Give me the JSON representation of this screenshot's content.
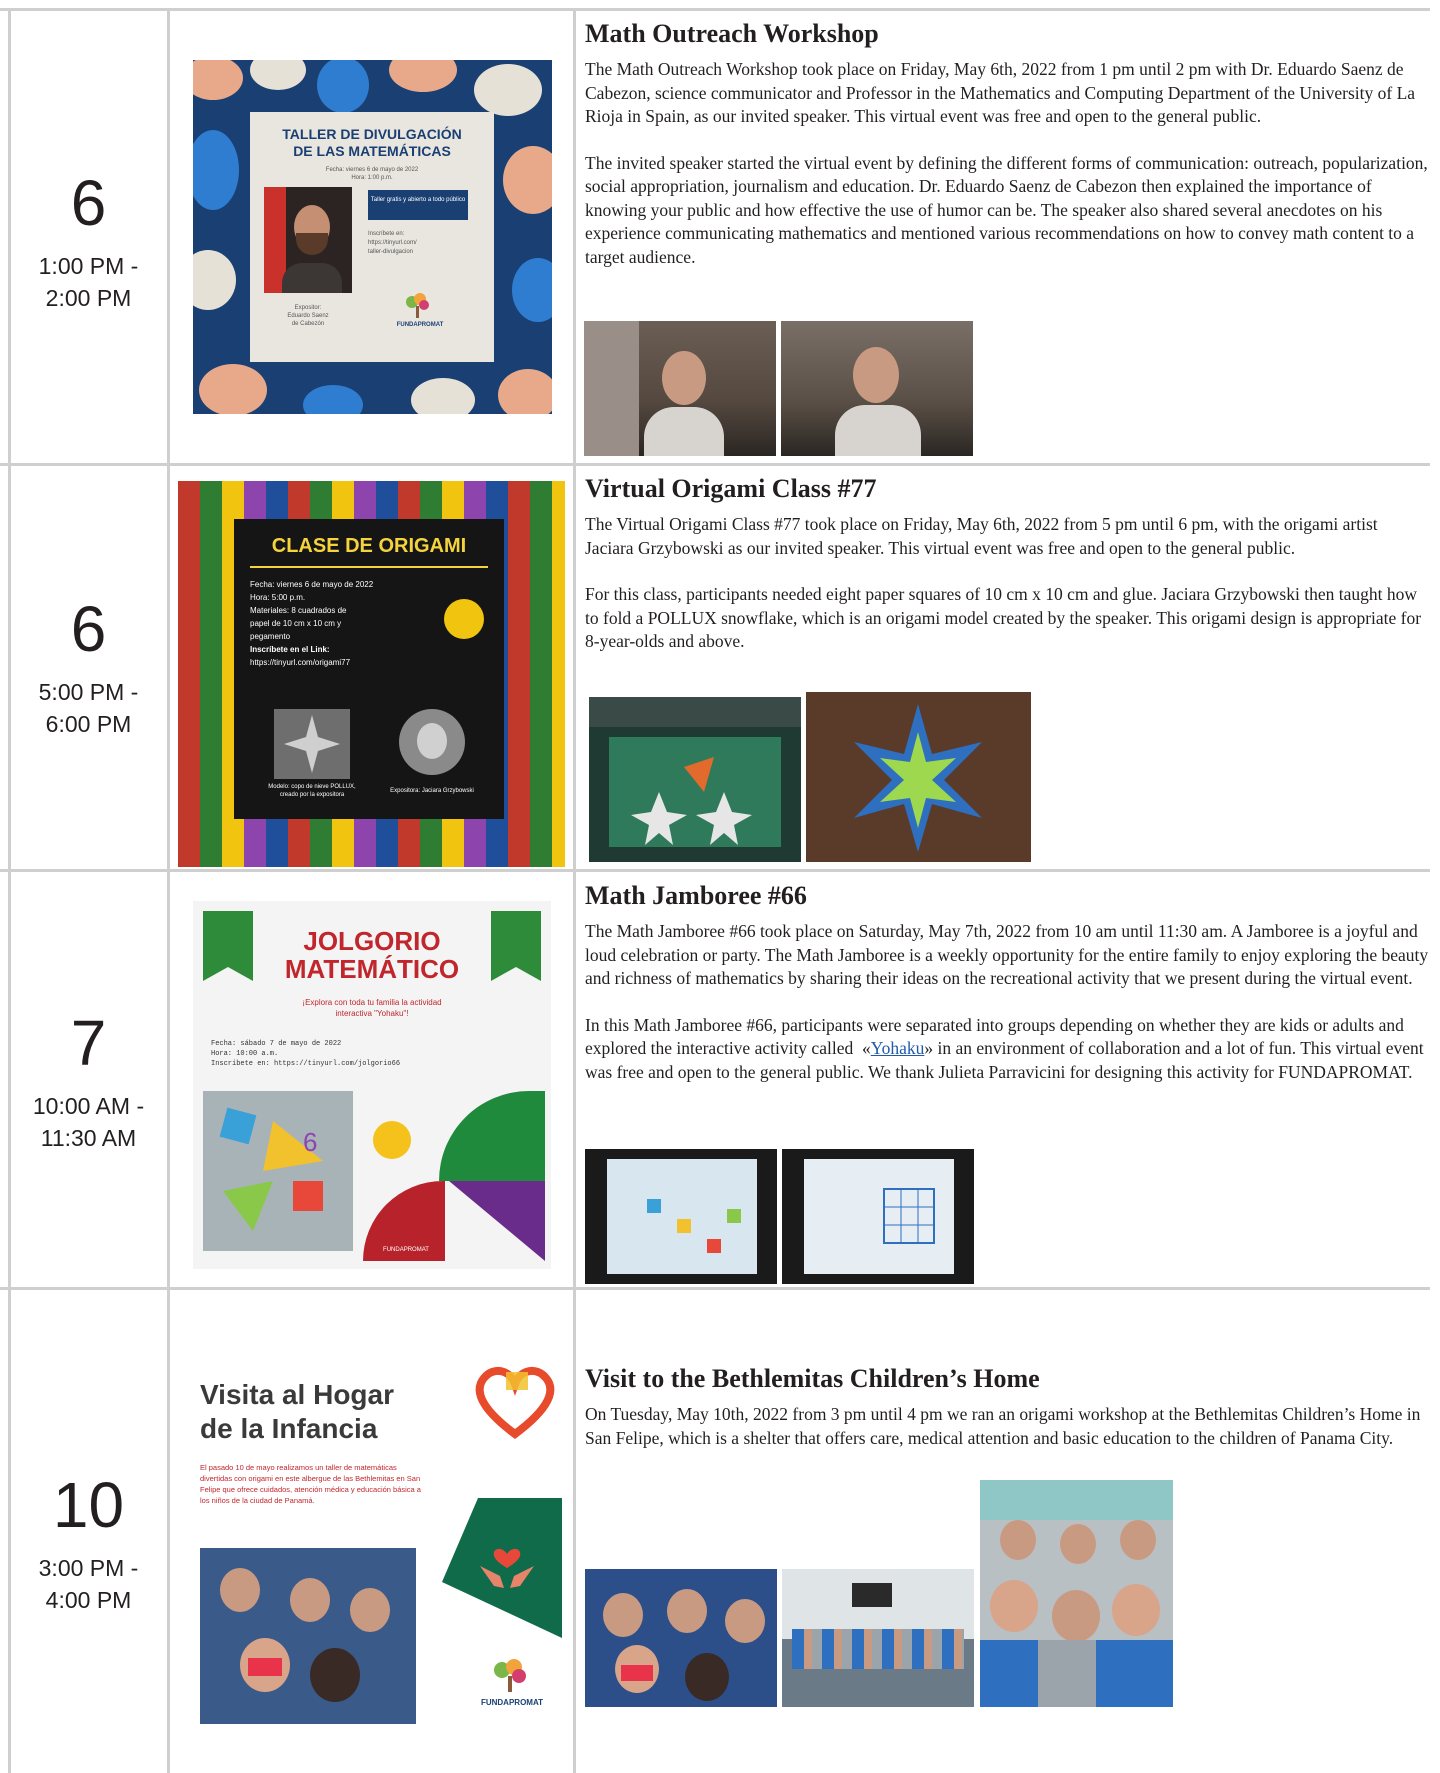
{
  "events": [
    {
      "day": "6",
      "time_line1": "1:00 PM -",
      "time_line2": "2:00 PM",
      "title": "Math Outreach Workshop",
      "paragraphs": [
        "The Math Outreach Workshop took place on Friday, May 6th, 2022 from 1 pm until 2 pm with Dr. Eduardo Saenz de Cabezon, science communicator and Professor in the Mathematics and Computing Department of the University of La Rioja in Spain, as our invited speaker. This virtual event was free and open to the general public.",
        "The invited speaker started the virtual event by defining the different forms of communication: outreach, popularization, social appropriation, journalism and education. Dr. Eduardo Saenz de Cabezon then explained the importance of knowing your public and how effective the use of humor can be. The speaker also shared several anecdotes on his experience communicating mathematics and mentioned various recommendations on how to convey math content to a target audience."
      ],
      "poster": {
        "heading_line1": "TALLER DE DIVULGACIÓN",
        "heading_line2": "DE LAS MATEMÁTICAS",
        "info_line1": "Fecha: viernes 6 de mayo de 2022",
        "info_line2": "Hora: 1:00 p.m.",
        "badge": "Taller gratis y abierto a todo público",
        "link_line1": "Inscríbete en:",
        "link_line2": "https://tinyurl.com/",
        "link_line3": "taller-divulgacion",
        "speaker_line1": "Expositor:",
        "speaker_line2": "Eduardo Saenz",
        "speaker_line3": "de Cabezón",
        "brand": "FUNDAPROMAT"
      }
    },
    {
      "day": "6",
      "time_line1": "5:00 PM -",
      "time_line2": "6:00 PM",
      "title": "Virtual Origami Class #77",
      "paragraphs": [
        "The Virtual Origami Class #77 took place on Friday, May 6th, 2022 from 5 pm until 6 pm, with the origami artist Jaciara Grzybowski as our invited speaker. This virtual event was free and open to the general public.",
        "For this class, participants needed eight paper squares of 10 cm x 10 cm and glue. Jaciara Grzybowski then taught how to fold a POLLUX snowflake, which is an origami model created by the speaker. This origami design is appropriate for 8-year-olds and above."
      ],
      "poster": {
        "heading": "CLASE DE ORIGAMI",
        "line1": "Fecha: viernes 6 de mayo de 2022",
        "line2": "Hora: 5:00 p.m.",
        "line3": "Materiales: 8 cuadrados de",
        "line4": "papel de 10 cm x 10 cm y",
        "line5": "pegamento",
        "line6": "Inscríbete en el Link:",
        "line7": "https://tinyurl.com/origami77",
        "model_caption": "Modelo: copo de nieve POLLUX, creado por la expositora",
        "speaker_caption": "Expositora: Jaciara Grzybowski"
      }
    },
    {
      "day": "7",
      "time_line1": "10:00 AM -",
      "time_line2": "11:30 AM",
      "title": "Math Jamboree #66",
      "paragraphs": [
        "The Math Jamboree #66 took place on Saturday, May 7th, 2022 from 10 am until 11:30 am. A Jamboree is a joyful and loud celebration or party. The Math Jamboree is a weekly opportunity for the entire family to enjoy exploring the beauty and richness of mathematics by sharing their ideas on the recreational activity that we present during the virtual event."
      ],
      "para2_before": "In this Math Jamboree #66, participants were separated into groups depending on whether they are kids or adults and explored the interactive activity called  «",
      "para2_link": "Yohaku",
      "para2_after": "» in an environment of collaboration and a lot of fun. This virtual event was free and open to the general public. We thank Julieta Parravicini for designing this activity for FUNDAPROMAT.",
      "poster": {
        "heading_line1": "JOLGORIO",
        "heading_line2": "MATEMÁTICO",
        "sub_line1": "¡Explora con toda tu familia la actividad",
        "sub_line2": "interactiva \"Yohaku\"!",
        "info1": "Fecha: sábado 7 de mayo de 2022",
        "info2": "Hora: 10:00 a.m.",
        "info3": "Inscríbete en: https://tinyurl.com/jolgorio66",
        "brand": "FUNDAPROMAT"
      }
    },
    {
      "day": "10",
      "time_line1": "3:00 PM -",
      "time_line2": "4:00 PM",
      "title": "Visit to the Bethlemitas Children’s Home",
      "paragraphs": [
        "On Tuesday, May 10th, 2022 from 3 pm until 4 pm we ran an origami workshop at the Bethlemitas Children’s Home in San Felipe, which is a shelter that offers care, medical attention and basic education to the children of Panama City."
      ],
      "poster": {
        "heading_line1": "Visita al Hogar",
        "heading_line2": "de la Infancia",
        "body": "El pasado 10 de mayo realizamos un taller de matemáticas divertidas con origami en este albergue de las Bethlemitas en San Felipe que ofrece cuidados, atención médica y educación básica a los niños de la ciudad de Panamá.",
        "brand": "FUNDAPROMAT"
      }
    }
  ]
}
